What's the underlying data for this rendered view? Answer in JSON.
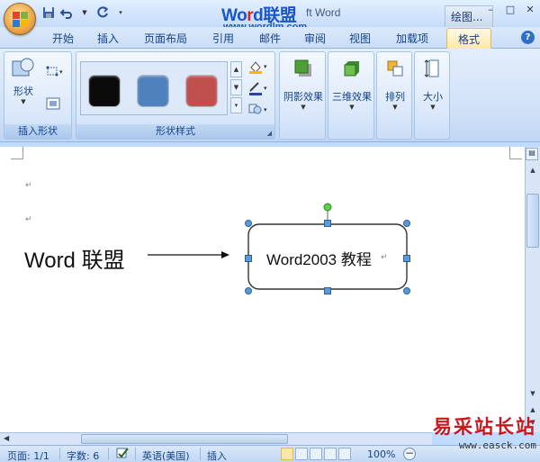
{
  "window": {
    "title_visible": "ft Word",
    "context_tab": "绘图...",
    "controls": [
      "–",
      "□",
      "✕"
    ]
  },
  "watermark": {
    "word_part": "Wo",
    "word_red": "r",
    "word_rest": "d",
    "cn": "联盟",
    "url": "www.wordlm.com"
  },
  "tabs": [
    "开始",
    "插入",
    "页面布局",
    "引用",
    "邮件",
    "审阅",
    "视图",
    "加载项",
    "格式"
  ],
  "active_tab": "格式",
  "ribbon": {
    "insert_shapes_group": {
      "label": "插入形状",
      "shapes_button": "形状"
    },
    "shape_styles_group": {
      "label": "形状样式",
      "swatch_colors": [
        "#0a0a0a",
        "#4f81bd",
        "#c0504d"
      ]
    },
    "shadow_button": "阴影效果",
    "threed_button": "三维效果",
    "arrange_button": "排列",
    "size_button": "大小"
  },
  "document": {
    "para_mark": "↵",
    "left_text": "Word 联盟",
    "box_text": "Word2003 教程"
  },
  "statusbar": {
    "page": "页面: 1/1",
    "words": "字数: 6",
    "language": "英语(美国)",
    "mode": "插入",
    "zoom": "100%"
  },
  "site_watermark": {
    "cn": "易采站长站",
    "en": "www.easck.com"
  }
}
